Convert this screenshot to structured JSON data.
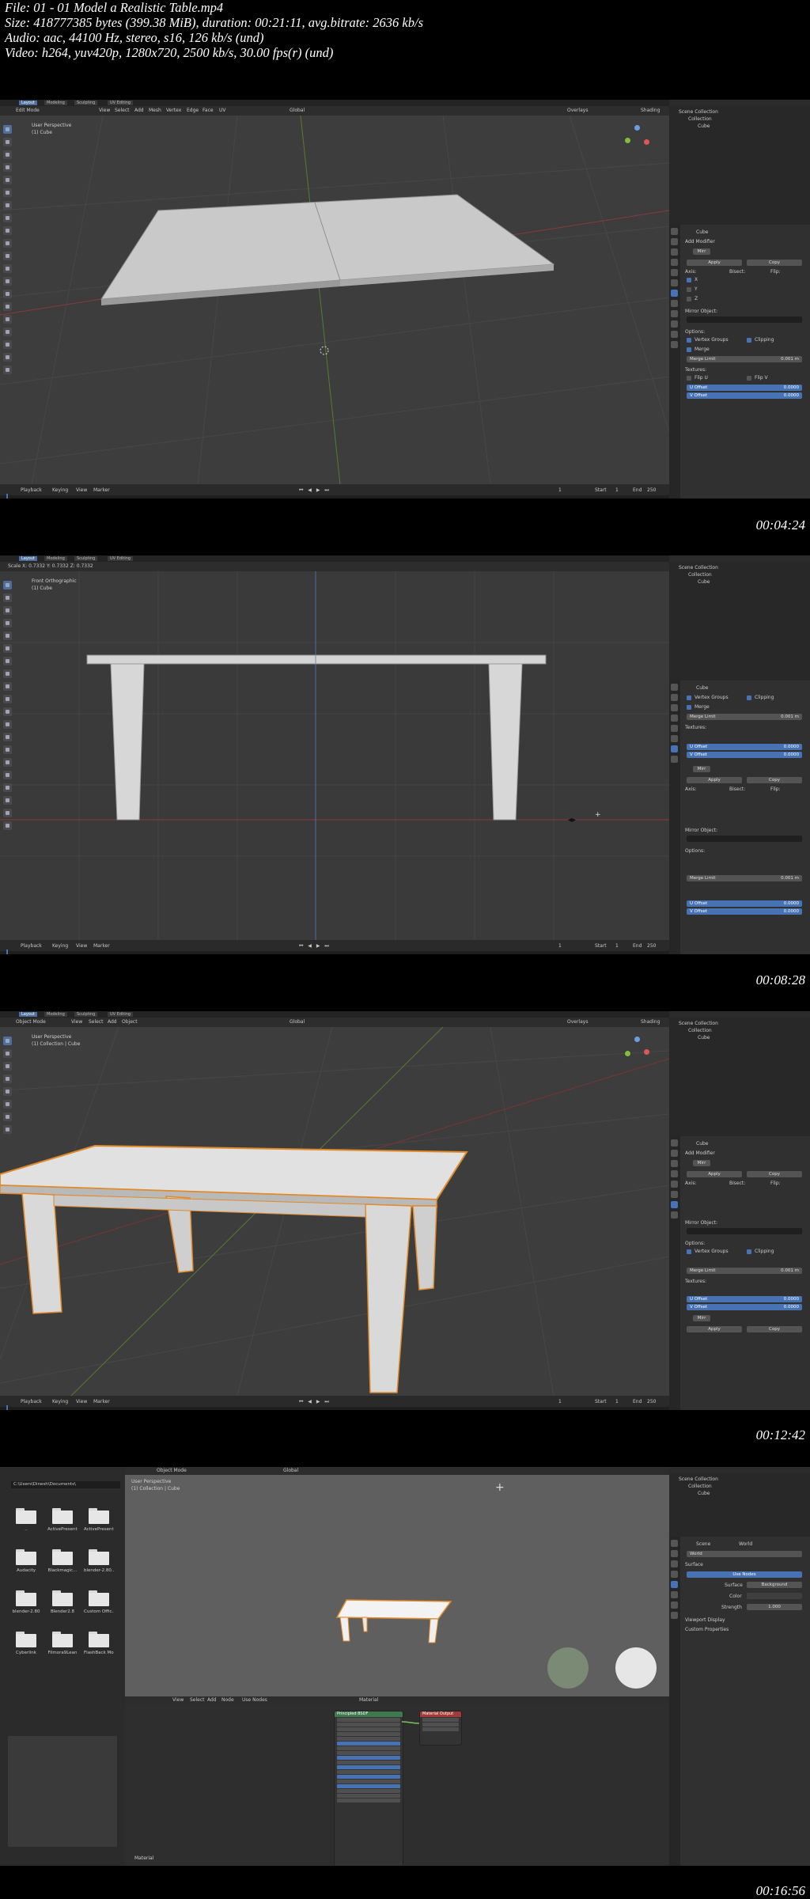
{
  "header": {
    "file": "File: 01 - 01 Model a Realistic Table.mp4",
    "size": "Size: 418777385 bytes (399.38 MiB), duration: 00:21:11, avg.bitrate: 2636 kb/s",
    "audio": "Audio: aac, 44100 Hz, stereo, s16, 126 kb/s (und)",
    "video": "Video: h264, yuv420p, 1280x720, 2500 kb/s, 30.00 fps(r) (und)"
  },
  "frames": [
    {
      "timestamp": "00:04:24",
      "tabs": [
        "Layout",
        "Modeling",
        "Sculpting",
        "UV Editing"
      ],
      "active_tab": 0,
      "mode": "Edit Mode",
      "menus": [
        "View",
        "Select",
        "Add",
        "Mesh",
        "Vertex",
        "Edge",
        "Face",
        "UV"
      ],
      "transform": "Global",
      "overlays": "Overlays",
      "shading": "Shading",
      "view_label": "User Perspective",
      "object_label": "(1) Cube",
      "timeline_menus": [
        "Playback",
        "Keying",
        "View",
        "Marker"
      ],
      "frame": "1",
      "start": "Start",
      "start_val": "1",
      "end": "End",
      "end_val": "250",
      "outliner": [
        "Scene Collection",
        "Collection",
        "Cube"
      ],
      "props_title": "Cube",
      "add_modifier": "Add Modifier",
      "modifier": "Mirr",
      "apply": "Apply",
      "copy": "Copy",
      "axis": "Axis:",
      "bisect": "Bisect:",
      "flip": "Flip:",
      "axes": [
        "X",
        "Y",
        "Z"
      ],
      "mirror_object": "Mirror Object:",
      "options": "Options:",
      "vertex_groups": "Vertex Groups",
      "clipping": "Clipping",
      "merge": "Merge",
      "merge_limit": "Merge Limit",
      "merge_limit_val": "0.001 m",
      "textures": "Textures:",
      "flip_u": "Flip U",
      "flip_v": "Flip V",
      "u_offset": "U Offset",
      "v_offset": "V Offset",
      "offset_val": "0.0000"
    },
    {
      "timestamp": "00:08:28",
      "view_label": "Front Orthographic",
      "object_label": "(1) Cube",
      "scale_info": "Scale X: 0.7332   Y: 0.7332   Z: 0.7332"
    },
    {
      "timestamp": "00:12:42",
      "mode": "Object Mode",
      "menus": [
        "View",
        "Select",
        "Add",
        "Object"
      ],
      "view_label": "User Perspective",
      "object_label": "(1) Collection | Cube"
    },
    {
      "timestamp": "00:16:56",
      "fb_path": "C:\\Users\\Dinesh\\Documents\\",
      "folders": [
        "..",
        "ActivePresent...",
        "ActivePresent...",
        "Audacity",
        "Blackmagic...",
        "blender-2.80...",
        "blender-2.80",
        "Blender2.8",
        "Custom Offic...",
        "Cyberlink",
        "Filmora9Lean",
        "FlashBack Mo..."
      ],
      "world_tab": "Scene",
      "world_name": "World",
      "surface": "Surface",
      "use_nodes": "Use Nodes",
      "surface_label": "Surface",
      "surface_val": "Background",
      "color_label": "Color",
      "strength_label": "Strength",
      "strength_val": "1.000",
      "viewport_display": "Viewport Display",
      "custom_props": "Custom Properties",
      "node_editor_menus": [
        "View",
        "Select",
        "Add",
        "Node"
      ],
      "node_use_nodes": "Use Nodes",
      "node_material": "Material",
      "principled": "Principled BSDF",
      "material_output": "Material Output",
      "material_label": "Material"
    }
  ]
}
